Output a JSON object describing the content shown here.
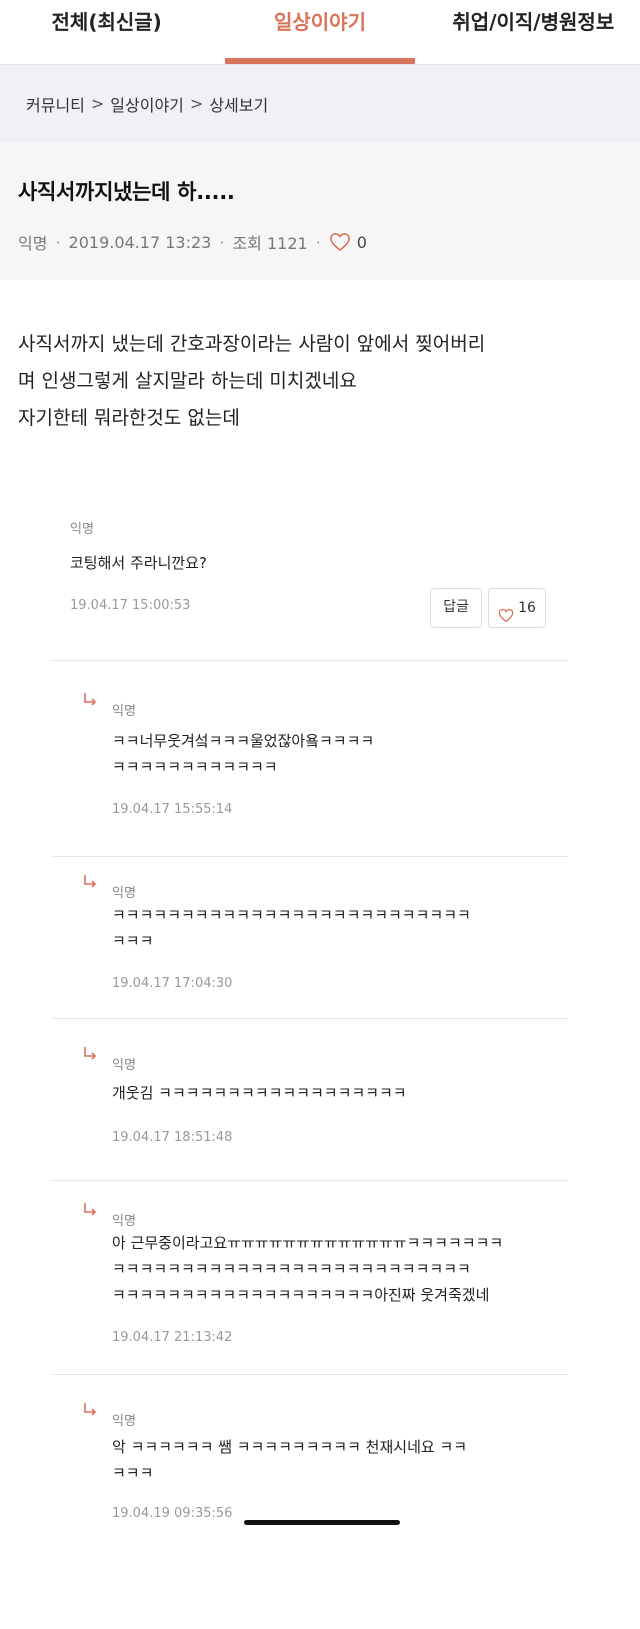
{
  "tabs": [
    {
      "label": "전체(최신글)"
    },
    {
      "label": "일상이야기"
    },
    {
      "label": "취업/이직/병원정보"
    }
  ],
  "breadcrumb": [
    "커뮤니티",
    "일상이야기",
    "상세보기"
  ],
  "breadcrumb_separator": ">",
  "post": {
    "title": "사직서까지냈는데 하.....",
    "author": "익명",
    "datetime": "2019.04.17 13:23",
    "views": "조회 1121",
    "likes": "0",
    "meta_separator": "·",
    "body": [
      "사직서까지 냈는데 간호과장이라는 사람이 앞에서 찢어버리",
      "며 인생그렇게 살지말라 하는데 미치겠네요",
      "자기한테 뭐라한것도 없는데"
    ]
  },
  "comments": [
    {
      "author": "익명",
      "text": "코팅해서 주라니깐요?",
      "date": "19.04.17 15:00:53",
      "reply_button": "답글",
      "likes": "16"
    }
  ],
  "replies": [
    {
      "author": "익명",
      "lines": [
        "ㅋㅋ너무웃겨섴ㅋㅋㅋ울었잖아욬ㅋㅋㅋㅋ",
        "ㅋㅋㅋㅋㅋㅋㅋㅋㅋㅋㅋㅋ"
      ],
      "date": "19.04.17 15:55:14"
    },
    {
      "author": "익명",
      "lines": [
        "ㅋㅋㅋㅋㅋㅋㅋㅋㅋㅋㅋㅋㅋㅋㅋㅋㅋㅋㅋㅋㅋㅋㅋㅋㅋㅋ",
        "ㅋㅋㅋ"
      ],
      "date": "19.04.17 17:04:30"
    },
    {
      "author": "익명",
      "lines": [
        "개웃김 ㅋㅋㅋㅋㅋㅋㅋㅋㅋㅋㅋㅋㅋㅋㅋㅋㅋㅋ"
      ],
      "date": "19.04.17 18:51:48"
    },
    {
      "author": "익명",
      "lines": [
        "아 근무중이라고요ㅠㅠㅠㅠㅠㅠㅠㅠㅠㅠㅠㅠㅠㅋㅋㅋㅋㅋㅋㅋ",
        "ㅋㅋㅋㅋㅋㅋㅋㅋㅋㅋㅋㅋㅋㅋㅋㅋㅋㅋㅋㅋㅋㅋㅋㅋㅋㅋ",
        "ㅋㅋㅋㅋㅋㅋㅋㅋㅋㅋㅋㅋㅋㅋㅋㅋㅋㅋㅋ아진짜 웃겨죽겠네"
      ],
      "date": "19.04.17 21:13:42"
    },
    {
      "author": "익명",
      "lines": [
        "악 ㅋㅋㅋㅋㅋㅋ 쌤 ㅋㅋㅋㅋㅋㅋㅋㅋㅋ 천재시네요 ㅋㅋ",
        "ㅋㅋㅋ"
      ],
      "date": "19.04.19 09:35:56"
    }
  ],
  "colors": {
    "accent": "#d9735a",
    "breadcrumb_bg": "#f1f1f5",
    "header_bg": "#f6f6f8"
  },
  "icons": {
    "like": "heart-outline-icon",
    "reply": "reply-arrow-icon"
  }
}
